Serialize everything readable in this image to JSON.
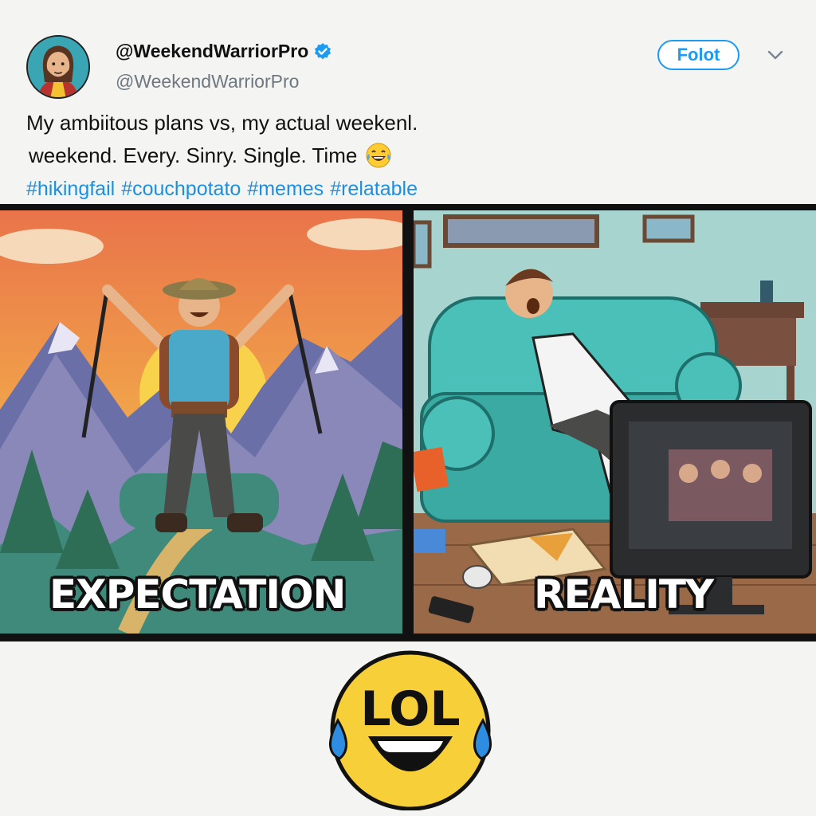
{
  "post": {
    "display_name": "@WeekendWarriorPro",
    "handle": "@WeekendWarriorPro",
    "follow_label": "Folot",
    "text_line1": "My ambiitous plans vs, my actual weekenl.",
    "text_line2": "weekend. Every. Sinry. Single. Time",
    "hashtags": [
      "#hikingfail",
      "#couchpotato",
      "#memes",
      "#relatable"
    ]
  },
  "meme": {
    "left_caption": "EXPECTATION",
    "right_caption": "REALITY"
  },
  "reaction": {
    "text": "LOL"
  },
  "colors": {
    "accent": "#1d9bf0",
    "hashtag": "#1d8fe0",
    "verified": "#1d9bf0"
  }
}
